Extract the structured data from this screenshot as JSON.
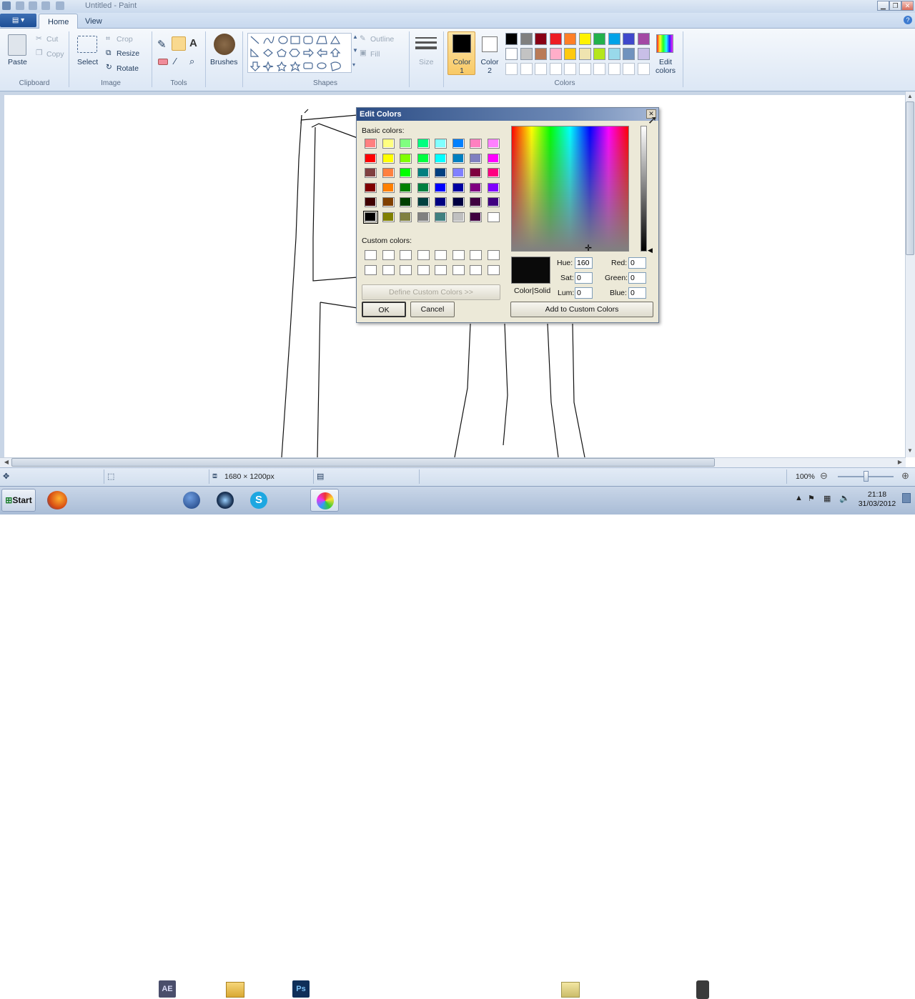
{
  "window": {
    "title": "Untitled - Paint",
    "minimize": "▁",
    "restore": "❐",
    "close": "✕"
  },
  "app_menu": {
    "label": "▤ ▾"
  },
  "tabs": [
    {
      "label": "Home"
    },
    {
      "label": "View"
    }
  ],
  "ribbon": {
    "clipboard": {
      "paste": "Paste",
      "cut": "Cut",
      "copy": "Copy",
      "label": "Clipboard"
    },
    "image": {
      "select": "Select",
      "crop": "Crop",
      "resize": "Resize",
      "rotate": "Rotate",
      "label": "Image"
    },
    "tools": {
      "label": "Tools"
    },
    "brushes": {
      "label": "Brushes"
    },
    "shapes": {
      "outline": "Outline",
      "fill": "Fill",
      "label": "Shapes"
    },
    "size": {
      "label": "Size"
    },
    "colors": {
      "color1": "Color 1",
      "color2": "Color 2",
      "edit_colors": "Edit colors",
      "label": "Colors",
      "palette_row1": [
        "#000000",
        "#7f7f7f",
        "#880015",
        "#ed1c24",
        "#ff7f27",
        "#fff200",
        "#22b14c",
        "#00a2e8",
        "#3f48cc",
        "#a349a4"
      ],
      "palette_row2": [
        "#ffffff",
        "#c3c3c3",
        "#b97a57",
        "#ffaec9",
        "#ffc90e",
        "#efe4b0",
        "#b5e61d",
        "#99d9ea",
        "#7092be",
        "#c8bfe7"
      ]
    }
  },
  "dialog": {
    "title": "Edit Colors",
    "basic_label": "Basic colors:",
    "custom_label": "Custom colors:",
    "define_custom": "Define Custom Colors >>",
    "ok": "OK",
    "cancel": "Cancel",
    "add_custom": "Add to Custom Colors",
    "color_solid": "Color|Solid",
    "hue_label": "Hue:",
    "hue": "160",
    "sat_label": "Sat:",
    "sat": "0",
    "lum_label": "Lum:",
    "lum": "0",
    "red_label": "Red:",
    "red": "0",
    "green_label": "Green:",
    "green": "0",
    "blue_label": "Blue:",
    "blue": "0",
    "basic_colors": [
      [
        "#ff8080",
        "#ffff80",
        "#80ff80",
        "#00ff80",
        "#80ffff",
        "#0080ff",
        "#ff80c0",
        "#ff80ff"
      ],
      [
        "#ff0000",
        "#ffff00",
        "#80ff00",
        "#00ff40",
        "#00ffff",
        "#0080c0",
        "#8080c0",
        "#ff00ff"
      ],
      [
        "#804040",
        "#ff8040",
        "#00ff00",
        "#008080",
        "#004080",
        "#8080ff",
        "#800040",
        "#ff0080"
      ],
      [
        "#800000",
        "#ff8000",
        "#008000",
        "#008040",
        "#0000ff",
        "#0000a0",
        "#800080",
        "#8000ff"
      ],
      [
        "#400000",
        "#804000",
        "#004000",
        "#004040",
        "#000080",
        "#000040",
        "#400040",
        "#400080"
      ],
      [
        "#000000",
        "#808000",
        "#808040",
        "#808080",
        "#408080",
        "#c0c0c0",
        "#400040",
        "#ffffff"
      ]
    ]
  },
  "status": {
    "dimensions": "1680 × 1200px",
    "zoom": "100%"
  },
  "taskbar": {
    "start": "Start",
    "ae": "AE",
    "ps": "Ps",
    "time": "21:18",
    "date": "31/03/2012"
  }
}
